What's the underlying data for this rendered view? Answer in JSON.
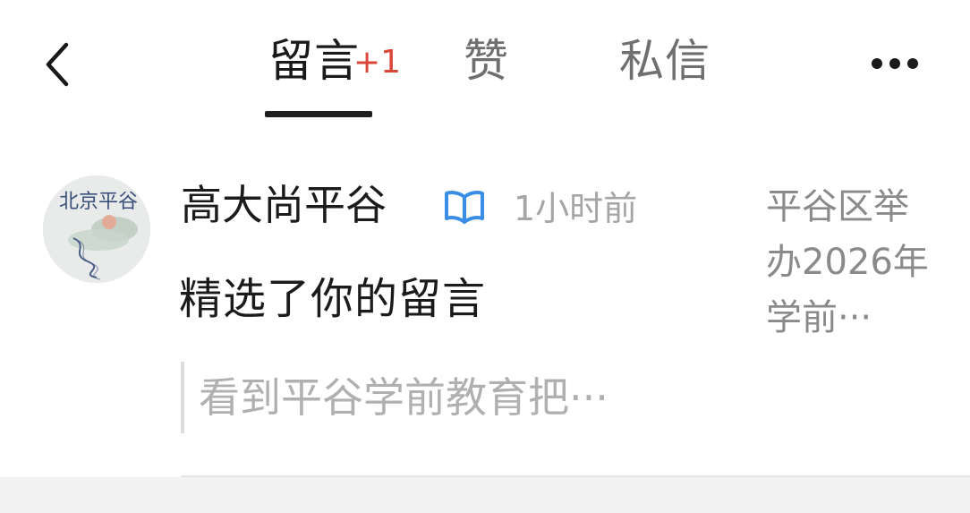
{
  "header": {
    "tabs": [
      {
        "label": "留言",
        "badge": "+1",
        "active": true
      },
      {
        "label": "赞",
        "active": false
      },
      {
        "label": "私信",
        "active": false
      }
    ],
    "back_icon": "chevron-left-icon",
    "more_icon": "more-horizontal-icon"
  },
  "notification": {
    "account_name": "高大尚平谷",
    "verified_icon": "book-verified-icon",
    "time": "1小时前",
    "action": "精选了你的留言",
    "quote": "看到平谷学前教育把···",
    "article_title": "平谷区举办2026年学前···",
    "avatar_text": "北京平谷"
  },
  "colors": {
    "badge": "#d9463a",
    "verified": "#3b8ee6",
    "active_tab": "#1a1a1a",
    "muted": "#a5a5a5"
  }
}
